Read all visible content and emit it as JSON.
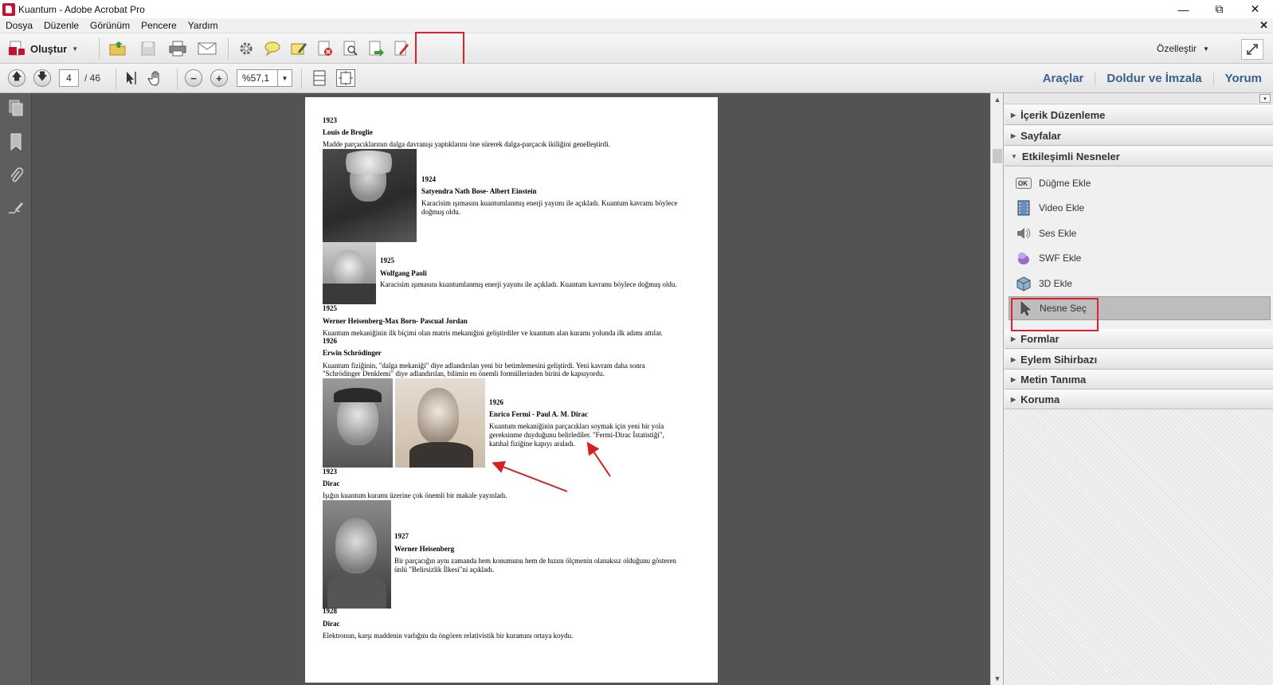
{
  "window": {
    "title": "Kuantum - Adobe Acrobat Pro"
  },
  "menu": [
    "Dosya",
    "Düzenle",
    "Görünüm",
    "Pencere",
    "Yardım"
  ],
  "toolbar": {
    "create_label": "Oluştur",
    "customize_label": "Özelleştir"
  },
  "nav": {
    "current_page": "4",
    "total_pages": "/ 46",
    "zoom": "%57,1"
  },
  "right_tabs": [
    "Araçlar",
    "Doldur ve İmzala",
    "Yorum"
  ],
  "tools_pane": {
    "panels_top": [
      "İçerik Düzenleme",
      "Sayfalar",
      "Etkileşimli Nesneler"
    ],
    "interactive_items": [
      {
        "label": "Düğme Ekle",
        "icon": "ok-button-icon"
      },
      {
        "label": "Video Ekle",
        "icon": "film-strip-icon"
      },
      {
        "label": "Ses Ekle",
        "icon": "speaker-icon"
      },
      {
        "label": "SWF Ekle",
        "icon": "swf-icon"
      },
      {
        "label": "3D Ekle",
        "icon": "cube-icon"
      },
      {
        "label": "Nesne Seç",
        "icon": "cursor-arrow-icon"
      }
    ],
    "panels_bottom": [
      "Formlar",
      "Eylem Sihirbazı",
      "Metin Tanıma",
      "Koruma"
    ]
  },
  "document": {
    "lines": [
      "1923",
      "Louis de Broglie",
      "Madde parçacıklarının dalga davranışı yaptıklarını öne sürerek dalga-parçacık ikiliğini genelleştirdi.",
      "1924",
      "Satyendra Nath Bose- Albert Einstein",
      "Karacisim ışımasını kuantumlanmış enerji yayımı ile açıkladı. Kuantum kavramı böylece",
      "doğmuş oldu.",
      "1925",
      "Wolfgang Paoli",
      "Karacisim ışımasını kuantumlanmış enerji yayımı ile açıkladı. Kuantum kavramı böylece doğmuş oldu.",
      "1925",
      "Werner Heisenberg-Max Born- Pascual Jordan",
      "Kuantum mekaniğinin ilk biçimi olan matris mekaniğini geliştirdiler ve kuantum alan kuramı yolunda ilk adımı attılar.",
      "1926",
      "Erwin Schrödinger",
      "Kuantum fiziğinin, \"dalga mekaniği\" diye adlandırılan yeni bir betimlemesini geliştirdi. Yeni kavram daha sonra",
      "\"Schrödinger Denklemi\" diye adlandırılan, bilimin en önemli formüllerinden birini de kapsıyordu.",
      "1926",
      "Enrico Fermi - Paul A. M. Dirac",
      "Kuantum mekaniğinin parçacıkları soymak için yeni bir yola",
      "gereksinme duyduğunu belirlediler. \"Fermi-Dirac İstatistiği\",",
      "katıhal fiziğine kapıyı araladı.",
      "1923",
      "Dirac",
      "Işığın kuantum kuramı üzerine çok önemli bir makale yayınladı.",
      "1927",
      "Werner Heisenberg",
      "Bir parçacığın aynı zamanda hem konumunu hem de hızını ölçmenin olanaksız olduğunu gösteren",
      "ünlü \"Belirsizlik İlkesi\"ni açıkladı.",
      "1928",
      "Dirac",
      "Elektronun, karşı maddenin varlığını da öngören relativistik bir kuramını ortaya koydu."
    ]
  },
  "colors": {
    "highlight_red": "#e0202a",
    "tab_blue": "#39618f",
    "doc_bg": "#535353"
  }
}
